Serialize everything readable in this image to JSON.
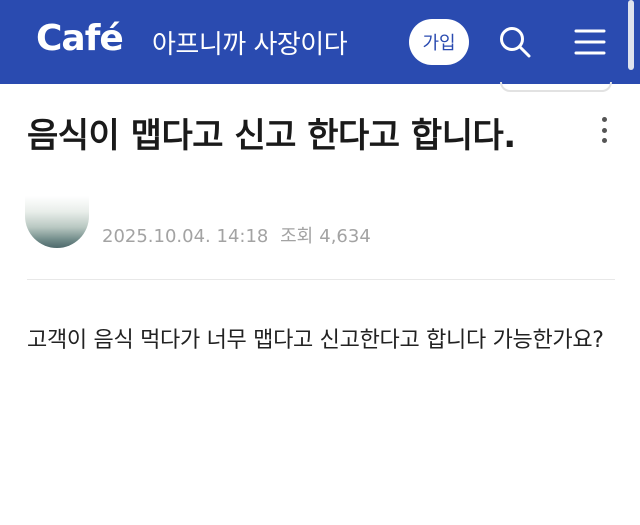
{
  "header": {
    "logo": "Café",
    "cafe_name": "아프니까 사장이다",
    "join_label": "가입",
    "icons": {
      "search": "search-icon",
      "menu": "menu-icon"
    },
    "colors": {
      "bar": "#2a4bb0",
      "button_bg": "#ffffff"
    }
  },
  "post": {
    "title": "음식이 맵다고 신고 한다고 합니다.",
    "date": "2025.10.04. 14:18",
    "views_label": "조회",
    "views": "4,634",
    "body": "고객이 음식 먹다가 너무 맵다고 신고한다고 합니다 가능한가요?"
  }
}
